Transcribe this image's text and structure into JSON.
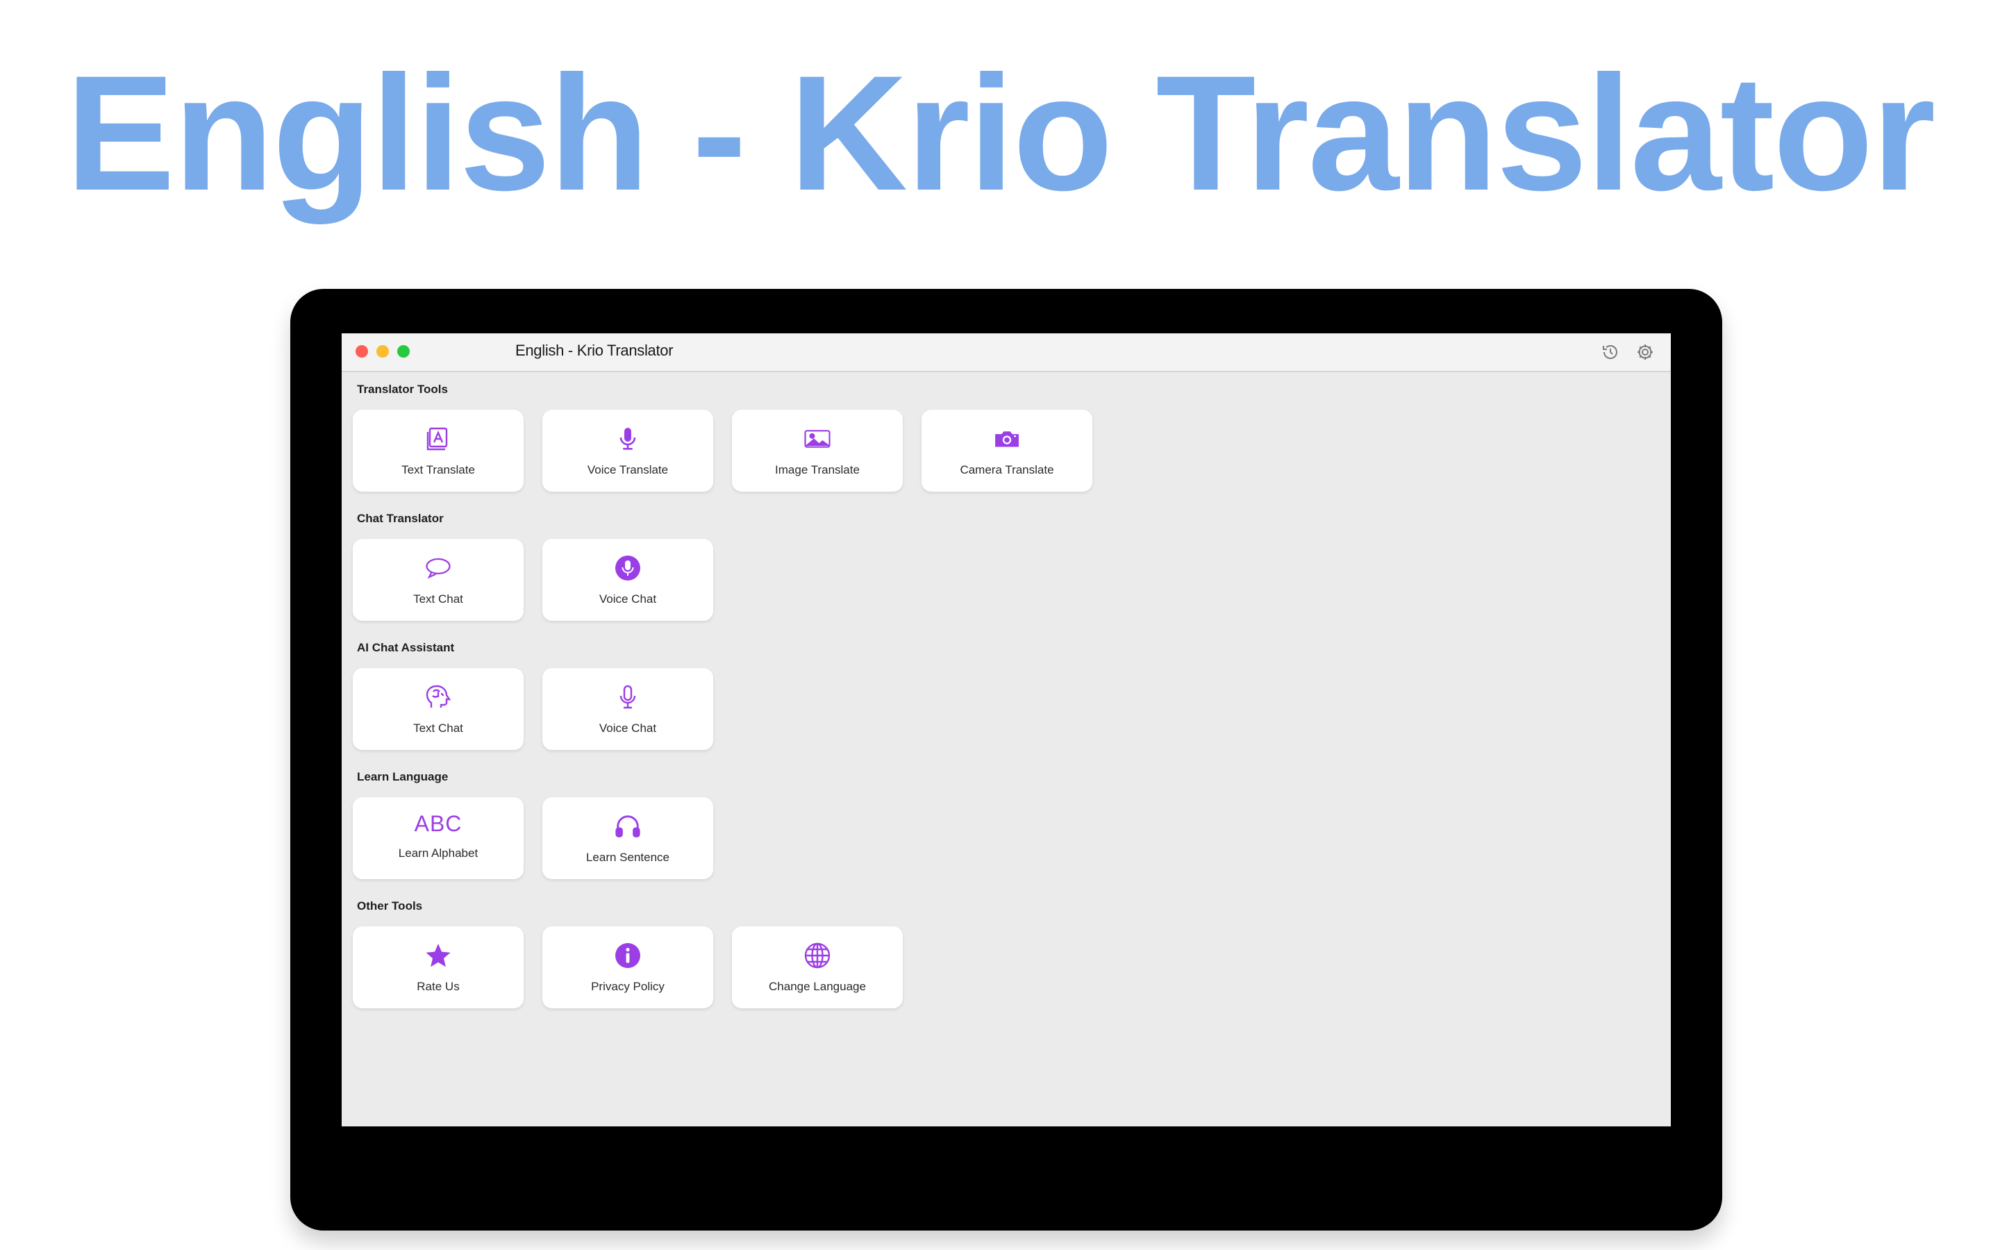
{
  "hero": {
    "title": "English - Krio Translator"
  },
  "window": {
    "title": "English - Krio Translator"
  },
  "sections": [
    {
      "label": "Translator Tools",
      "items": [
        {
          "label": "Text Translate",
          "icon": "text-translate-icon"
        },
        {
          "label": "Voice Translate",
          "icon": "microphone-icon"
        },
        {
          "label": "Image Translate",
          "icon": "image-icon"
        },
        {
          "label": "Camera Translate",
          "icon": "camera-icon"
        }
      ]
    },
    {
      "label": "Chat Translator",
      "items": [
        {
          "label": "Text Chat",
          "icon": "chat-bubble-icon"
        },
        {
          "label": "Voice Chat",
          "icon": "microphone-circle-icon"
        }
      ]
    },
    {
      "label": "AI Chat Assistant",
      "items": [
        {
          "label": "Text Chat",
          "icon": "brain-head-icon"
        },
        {
          "label": "Voice Chat",
          "icon": "microphone-outline-icon"
        }
      ]
    },
    {
      "label": "Learn Language",
      "items": [
        {
          "label": "Learn Alphabet",
          "icon": "abc-icon",
          "glyph": "ABC"
        },
        {
          "label": "Learn Sentence",
          "icon": "headphones-icon"
        }
      ]
    },
    {
      "label": "Other Tools",
      "items": [
        {
          "label": "Rate Us",
          "icon": "star-icon"
        },
        {
          "label": "Privacy Policy",
          "icon": "info-icon"
        },
        {
          "label": "Change Language",
          "icon": "globe-icon"
        }
      ]
    }
  ],
  "colors": {
    "accent": "#9b3ee6",
    "hero": "#79aaea"
  }
}
